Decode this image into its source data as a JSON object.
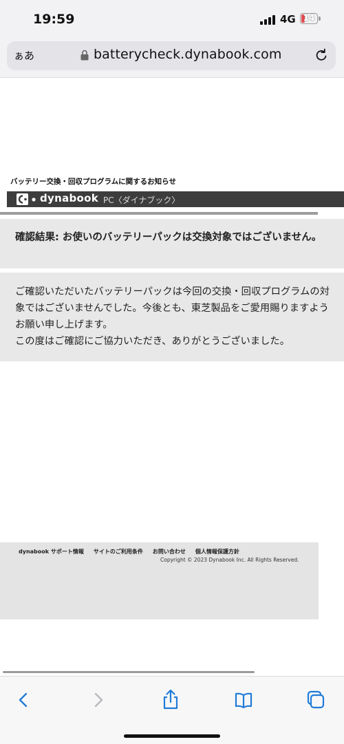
{
  "status": {
    "time": "19:59",
    "network": "4G",
    "battery": "14"
  },
  "browser": {
    "aa_label": "ぁあ",
    "url": "batterycheck.dynabook.com"
  },
  "page": {
    "heading": "バッテリー交換・回収プログラムに関するお知らせ",
    "logo": {
      "brand": "dynabook",
      "sub": "PC〈ダイナブック〉"
    },
    "result": "確認結果: お使いのバッテリーパックは交換対象ではございません。",
    "message_lines": [
      "ご確認いただいたバッテリーパックは今回の交換・回収プログラムの対象ではございませんでした。今後とも、東芝製品をご愛用賜りますようお願い申し上げます。",
      "この度はご確認にご協力いただき、ありがとうございました。"
    ],
    "footer": {
      "links": [
        "dynabook サポート情報",
        "サイトのご利用条件",
        "お問い合わせ",
        "個人情報保護方針"
      ],
      "copyright": "Copyright © 2023 Dynabook Inc. All Rights Reserved."
    }
  },
  "colors": {
    "accent": "#1f7bd8",
    "logo_bar": "#3d3d3d",
    "box_bg": "#e8e8e8"
  }
}
